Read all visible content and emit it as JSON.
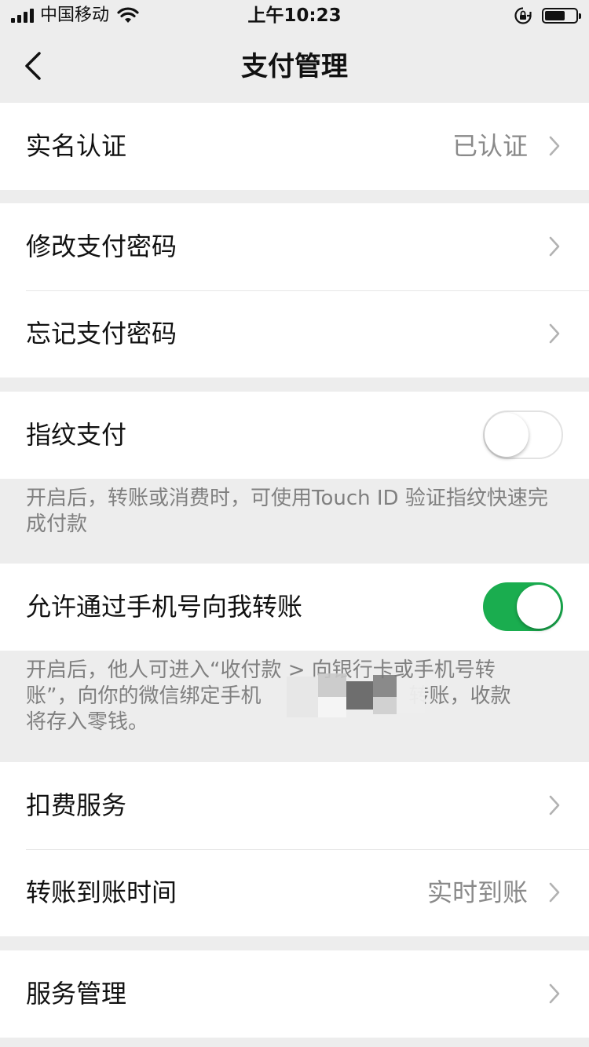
{
  "status_bar": {
    "carrier": "中国移动",
    "time": "上午10:23",
    "battery_level": 0.65
  },
  "nav": {
    "title": "支付管理",
    "back_icon": "chevron-left-icon"
  },
  "cells": {
    "realname": {
      "label": "实名认证",
      "value": "已认证"
    },
    "change_password": {
      "label": "修改支付密码"
    },
    "forgot_password": {
      "label": "忘记支付密码"
    },
    "fingerprint": {
      "label": "指纹支付",
      "enabled": false,
      "note": "开启后，转账或消费时，可使用Touch ID 验证指纹快速完成付款"
    },
    "phone_transfer": {
      "label": "允许通过手机号向我转账",
      "enabled": true,
      "note_line1": "开启后，他人可进入“收付款 > 向银行卡或手机号转",
      "note_line2a": "账”，向你的微信绑定手机",
      "note_line2b": "转账，收款",
      "note_line3": "将存入零钱。"
    },
    "deduction": {
      "label": "扣费服务"
    },
    "arrival_time": {
      "label": "转账到账时间",
      "value": "实时到账"
    },
    "service_manage": {
      "label": "服务管理"
    }
  },
  "colors": {
    "toggle_on": "#1aad4f",
    "background": "#ededed",
    "value_text": "#8a8a8a"
  }
}
